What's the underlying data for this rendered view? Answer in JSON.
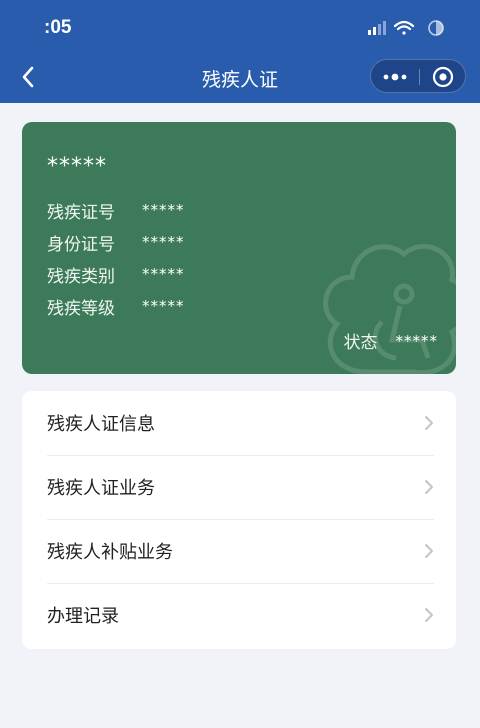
{
  "status_bar": {
    "time": ":05"
  },
  "nav": {
    "title": "残疾人证"
  },
  "card": {
    "name": "*****",
    "rows": [
      {
        "label": "残疾证号",
        "value": "*****"
      },
      {
        "label": "身份证号",
        "value": "*****"
      },
      {
        "label": "残疾类别",
        "value": "*****"
      },
      {
        "label": "残疾等级",
        "value": "*****"
      }
    ],
    "status_label": "状态",
    "status_value": "*****",
    "background_color": "#3d7a5a"
  },
  "menu": {
    "items": [
      {
        "label": "残疾人证信息"
      },
      {
        "label": "残疾人证业务"
      },
      {
        "label": "残疾人补贴业务"
      },
      {
        "label": "办理记录"
      }
    ]
  },
  "theme": {
    "header_color": "#2a5cad",
    "page_background": "#f1f3f8"
  }
}
